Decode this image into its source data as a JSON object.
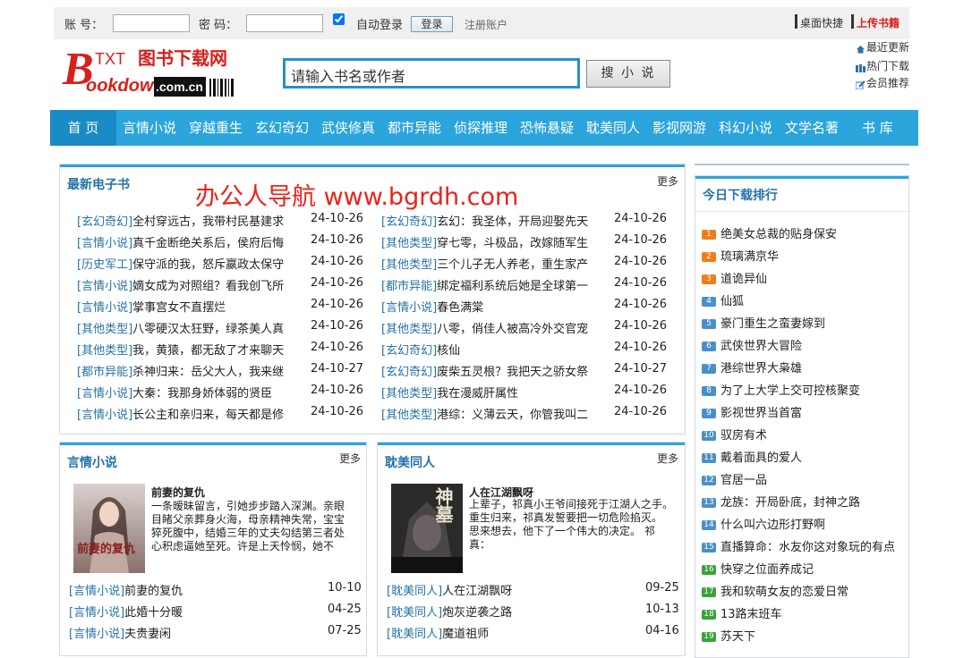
{
  "login": {
    "account_label": "账 号：",
    "password_label": "密 码：",
    "auto_login_label": "自动登录",
    "login_button": "登录",
    "register_link": "注册账户",
    "bookmark_link": "桌面快捷",
    "upload_link": "上传书籍"
  },
  "logo": {
    "top": "TXT 图书下载网",
    "bottom": "Bookdown",
    "domain": ".com.cn"
  },
  "search": {
    "placeholder": "请输入书名或作者",
    "button": "搜 小 说"
  },
  "quick_links": [
    "最近更新",
    "热门下载",
    "会员推荐"
  ],
  "nav": [
    "首 页",
    "言情小说",
    "穿越重生",
    "玄幻奇幻",
    "武侠修真",
    "都市异能",
    "侦探推理",
    "恐怖悬疑",
    "耽美同人",
    "影视网游",
    "科幻小说",
    "文学名著",
    "书 库"
  ],
  "watermark": "办公人导航 www.bgrdh.com",
  "latest": {
    "title": "最新电子书",
    "more": "更多",
    "left": [
      {
        "cat": "[玄幻奇幻]",
        "title": "全村穿远古，我带村民基建求",
        "date": "24-10-26"
      },
      {
        "cat": "[言情小说]",
        "title": "真千金断绝关系后，侯府后悔",
        "date": "24-10-26"
      },
      {
        "cat": "[历史军工]",
        "title": "保守派的我，怒斥嬴政太保守",
        "date": "24-10-26"
      },
      {
        "cat": "[言情小说]",
        "title": "嫡女成为对照组？看我创飞所",
        "date": "24-10-26"
      },
      {
        "cat": "[言情小说]",
        "title": "掌事宫女不直摆烂",
        "date": "24-10-26"
      },
      {
        "cat": "[其他类型]",
        "title": "八零硬汉太狂野，绿茶美人真",
        "date": "24-10-26"
      },
      {
        "cat": "[其他类型]",
        "title": "我，黄猿，都无敌了才来聊天",
        "date": "24-10-26"
      },
      {
        "cat": "[都市异能]",
        "title": "杀神归来：岳父大人，我来继",
        "date": "24-10-27"
      },
      {
        "cat": "[言情小说]",
        "title": "大秦：我那身娇体弱的贤臣",
        "date": "24-10-26"
      },
      {
        "cat": "[言情小说]",
        "title": "长公主和亲归来，每天都是修",
        "date": "24-10-26"
      }
    ],
    "right": [
      {
        "cat": "[玄幻奇幻]",
        "title": "玄幻：我圣体，开局迎娶先天",
        "date": "24-10-26"
      },
      {
        "cat": "[其他类型]",
        "title": "穿七零，斗极品，改嫁随军生",
        "date": "24-10-26"
      },
      {
        "cat": "[其他类型]",
        "title": "三个儿子无人养老，重生家产",
        "date": "24-10-26"
      },
      {
        "cat": "[都市异能]",
        "title": "绑定福利系统后她是全球第一",
        "date": "24-10-26"
      },
      {
        "cat": "[言情小说]",
        "title": "春色满棠",
        "date": "24-10-26"
      },
      {
        "cat": "[其他类型]",
        "title": "八零，俏佳人被高冷外交官宠",
        "date": "24-10-26"
      },
      {
        "cat": "[玄幻奇幻]",
        "title": "核仙",
        "date": "24-10-26"
      },
      {
        "cat": "[玄幻奇幻]",
        "title": "废柴五灵根？我把天之骄女祭",
        "date": "24-10-27"
      },
      {
        "cat": "[其他类型]",
        "title": "我在漫威肝属性",
        "date": "24-10-26"
      },
      {
        "cat": "[其他类型]",
        "title": "港综：义薄云天，你管我叫二",
        "date": "24-10-26"
      }
    ]
  },
  "ranking": {
    "title": "今日下载排行",
    "items": [
      "绝美女总裁的贴身保安",
      "琉璃满京华",
      "道诡异仙",
      "仙狐",
      "豪门重生之蛮妻嫁到",
      "武侠世界大冒险",
      "港综世界大枭雄",
      "为了上大学上交可控核聚变",
      "影视世界当首富",
      "驭房有术",
      "戴着面具的爱人",
      "官居一品",
      "龙族：开局卧底，封神之路",
      "什么叫六边形打野啊",
      "直播算命：水友你这对象玩的有点",
      "快穿之位面养成记",
      "我和软萌女友的恋爱日常",
      "13路末班车",
      "苏天下"
    ],
    "badge_colors": [
      "#f07d1a",
      "#f07d1a",
      "#f07d1a",
      "#4a90c8",
      "#4a90c8",
      "#4a90c8",
      "#4a90c8",
      "#4a90c8",
      "#4a90c8",
      "#4a90c8",
      "#4a90c8",
      "#4a90c8",
      "#4a90c8",
      "#4a90c8",
      "#4a90c8",
      "#3aa23a",
      "#3aa23a",
      "#3aa23a",
      "#3aa23a"
    ]
  },
  "romance": {
    "title": "言情小说",
    "more": "更多",
    "featured": {
      "title": "前妻的复仇",
      "desc": "一条暧昧留言，引她步步踏入深渊。亲眼目睹父亲葬身火海，母亲精神失常，宝宝猝死腹中，结婚三年的丈夫勾结第三者处心积虑逼她至死。许是上天怜悯，她不",
      "cover_text": "前妻的复仇"
    },
    "list": [
      {
        "cat": "[言情小说]",
        "title": "前妻的复仇",
        "date": "10-10"
      },
      {
        "cat": "[言情小说]",
        "title": "此婚十分暖",
        "date": "04-25"
      },
      {
        "cat": "[言情小说]",
        "title": "夫贵妻闲",
        "date": "07-25"
      }
    ]
  },
  "danmei": {
    "title": "耽美同人",
    "more": "更多",
    "featured": {
      "title": "人在江湖飘呀",
      "desc": "上辈子，祁真小王爷间接死于江湖人之手。 重生归来，祁真发誓要把一切危险掐灭。 思来想去，他下了一个伟大的决定。 祁真：",
      "cover_text": "神墓"
    },
    "list": [
      {
        "cat": "[耽美同人]",
        "title": "人在江湖飘呀",
        "date": "09-25"
      },
      {
        "cat": "[耽美同人]",
        "title": "炮灰逆袭之路",
        "date": "10-13"
      },
      {
        "cat": "[耽美同人]",
        "title": "魔道祖师",
        "date": "04-16"
      }
    ]
  }
}
